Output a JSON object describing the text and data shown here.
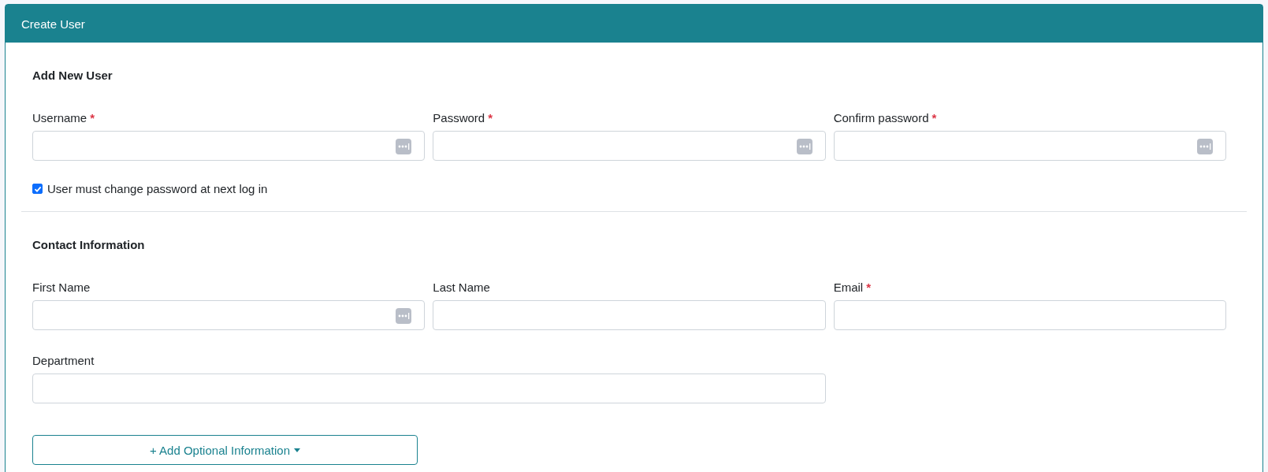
{
  "panel": {
    "title": "Create User"
  },
  "sections": [
    {
      "heading": "Add New User",
      "fields": [
        {
          "label": "Username",
          "required_mark": "*",
          "autofill_icon": true
        },
        {
          "label": "Password",
          "required_mark": "*",
          "autofill_icon": true
        },
        {
          "label": "Confirm password",
          "required_mark": "*",
          "autofill_icon": true
        }
      ],
      "checkbox": {
        "label": "User must change password at next log in",
        "checked": true
      }
    },
    {
      "heading": "Contact Information",
      "fields": [
        {
          "label": "First Name",
          "autofill_icon": true
        },
        {
          "label": "Last Name",
          "autofill_icon": false
        },
        {
          "label": "Email",
          "required_mark": "*",
          "autofill_icon": false
        },
        {
          "label": "Department",
          "autofill_icon": false,
          "wide": true
        }
      ]
    }
  ],
  "button": {
    "label": "+ Add Optional Information"
  }
}
